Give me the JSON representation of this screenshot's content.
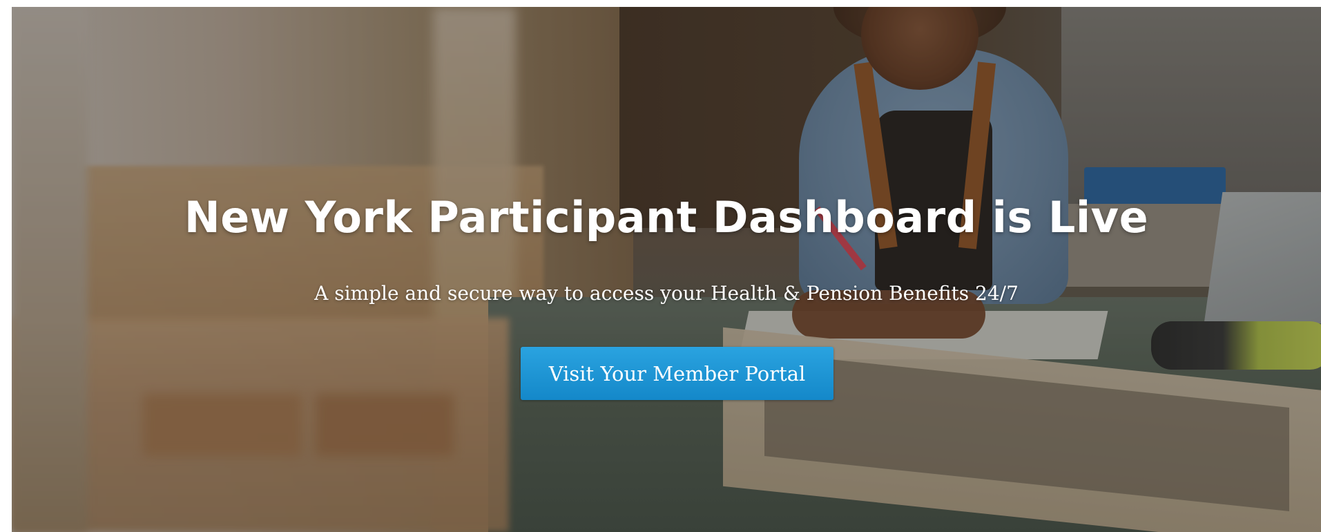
{
  "hero": {
    "headline": "New York Participant Dashboard is Live",
    "subheadline": "A simple and secure way to access your Health & Pension Benefits 24/7",
    "cta_label": "Visit Your Member Portal"
  },
  "colors": {
    "button_blue": "#1a95d4",
    "text_white": "#ffffff"
  }
}
